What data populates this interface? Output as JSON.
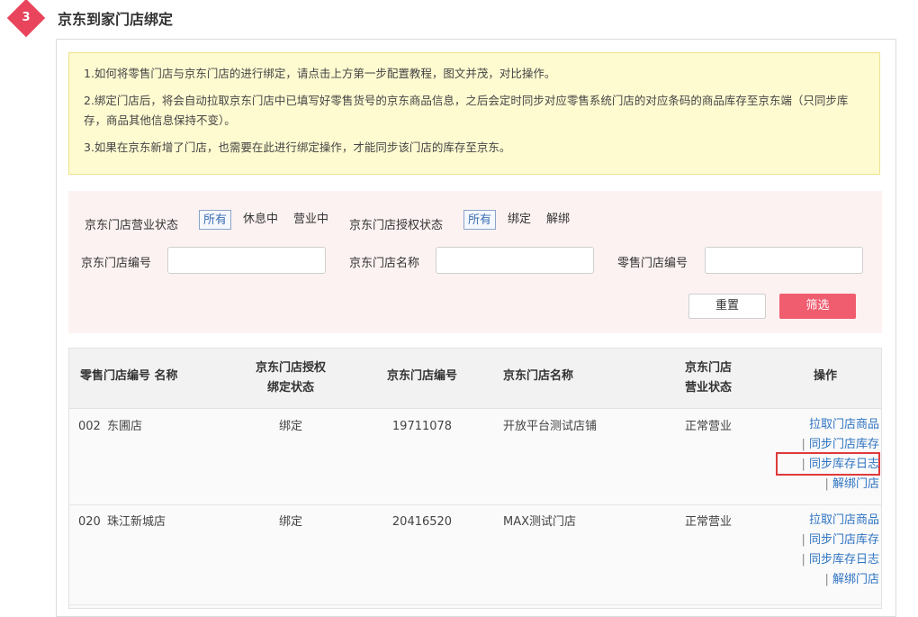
{
  "header": {
    "step_number": "3",
    "title": "京东到家门店绑定"
  },
  "notice": {
    "lines": [
      "1.如何将零售门店与京东门店的进行绑定，请点击上方第一步配置教程，图文并茂，对比操作。",
      "2.绑定门店后，将会自动拉取京东门店中已填写好零售货号的京东商品信息，之后会定时同步对应零售系统门店的对应条码的商品库存至京东端（只同步库存，商品其他信息保持不变）。",
      "3.如果在京东新增了门店，也需要在此进行绑定操作，才能同步该门店的库存至京东。"
    ]
  },
  "filters": {
    "business_status": {
      "label": "京东门店营业状态",
      "options": [
        "所有",
        "休息中",
        "营业中"
      ],
      "selected": "所有"
    },
    "auth_status": {
      "label": "京东门店授权状态",
      "options": [
        "所有",
        "绑定",
        "解绑"
      ],
      "selected": "所有"
    },
    "jd_store_no": {
      "label": "京东门店编号",
      "value": "",
      "placeholder": ""
    },
    "jd_store_name": {
      "label": "京东门店名称",
      "value": "",
      "placeholder": ""
    },
    "retail_store_no": {
      "label": "零售门店编号",
      "value": "",
      "placeholder": ""
    },
    "reset_label": "重置",
    "filter_label": "筛选"
  },
  "table": {
    "headers": {
      "retail": "零售门店编号 名称",
      "auth_line1": "京东门店授权",
      "auth_line2": "绑定状态",
      "jd_no": "京东门店编号",
      "jd_name": "京东门店名称",
      "biz_line1": "京东门店",
      "biz_line2": "营业状态",
      "ops": "操作"
    },
    "rows": [
      {
        "retail_no": "002",
        "retail_name": "东圃店",
        "auth_status": "绑定",
        "jd_no": "19711078",
        "jd_name": "开放平台测试店铺",
        "biz_status": "正常营业"
      },
      {
        "retail_no": "020",
        "retail_name": "珠江新城店",
        "auth_status": "绑定",
        "jd_no": "20416520",
        "jd_name": "MAX测试门店",
        "biz_status": "正常营业"
      }
    ],
    "ops": {
      "pull_goods": "拉取门店商品",
      "sync_stock": "同步门店库存",
      "sync_log": "同步库存日志",
      "unbind": "解绑门店",
      "separator": "|"
    }
  },
  "colors": {
    "accent": "#ef5d6f",
    "link": "#2f74c2",
    "highlight": "#e03a3a"
  }
}
